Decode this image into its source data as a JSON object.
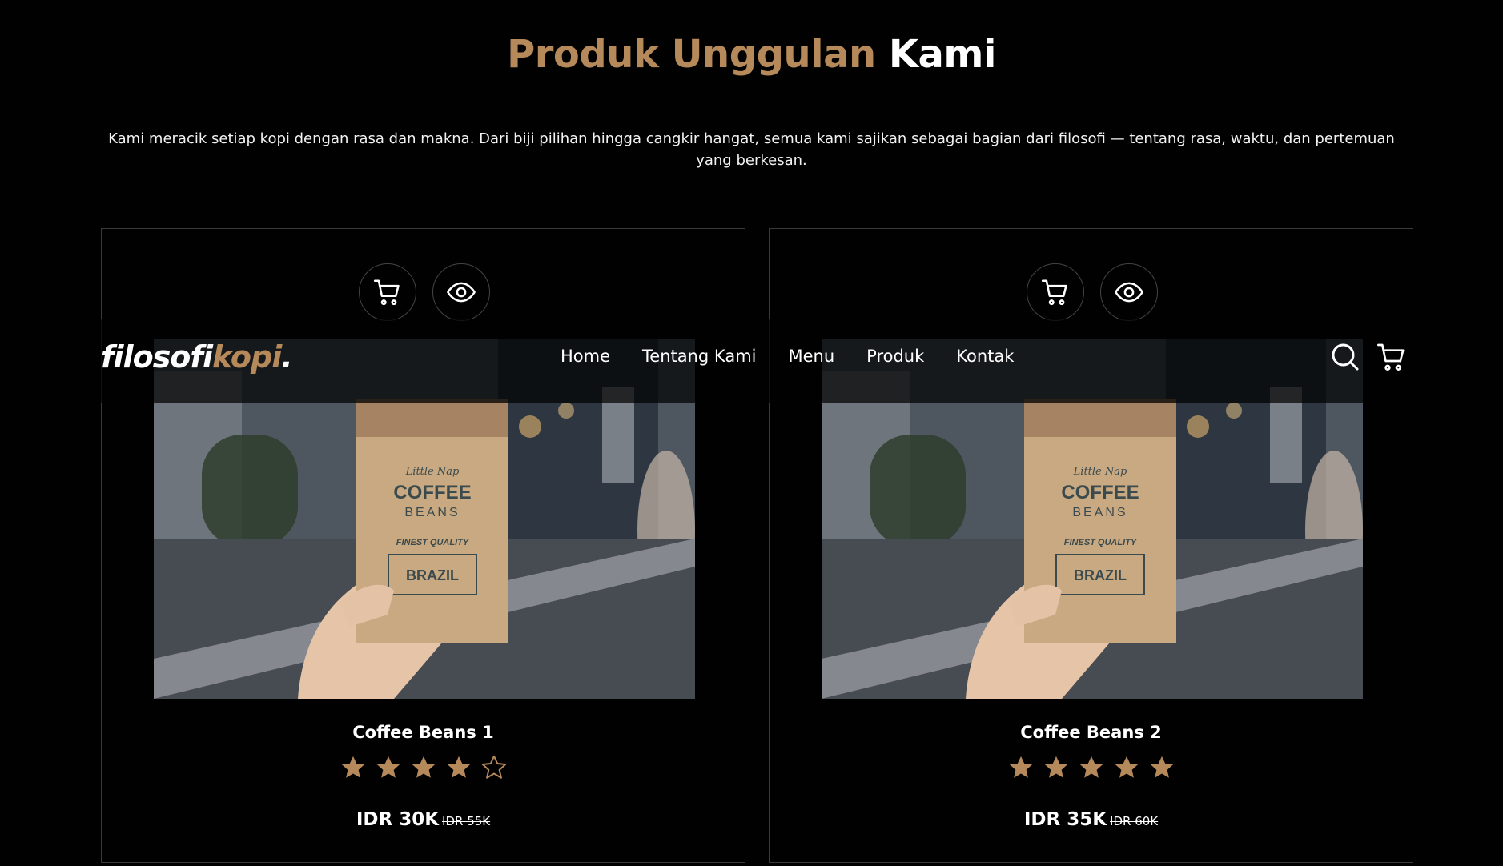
{
  "section": {
    "title_accent": "Produk Unggulan",
    "title_rest": "Kami",
    "subtitle": "Kami meracik setiap kopi dengan rasa dan makna. Dari biji pilihan hingga cangkir hangat, semua kami sajikan sebagai bagian dari filosofi — tentang rasa, waktu, dan pertemuan yang berkesan."
  },
  "navbar": {
    "logo_main": "filosofi",
    "logo_accent": "kopi",
    "logo_dot": ".",
    "links": [
      "Home",
      "Tentang Kami",
      "Menu",
      "Produk",
      "Kontak"
    ],
    "icons": [
      "search-icon",
      "cart-icon"
    ]
  },
  "products": [
    {
      "name": "Coffee Beans 1",
      "rating": 4,
      "rating_max": 5,
      "price": "IDR 30K",
      "old_price": "IDR 55K",
      "bag_text": {
        "brand": "Little Nap",
        "line1": "COFFEE",
        "line2": "BEANS",
        "quality": "FINEST QUALITY",
        "origin": "BRAZIL"
      }
    },
    {
      "name": "Coffee Beans 2",
      "rating": 5,
      "rating_max": 5,
      "price": "IDR 35K",
      "old_price": "IDR 60K",
      "bag_text": {
        "brand": "Little Nap",
        "line1": "COFFEE",
        "line2": "BEANS",
        "quality": "FINEST QUALITY",
        "origin": "BRAZIL"
      }
    }
  ],
  "colors": {
    "accent": "#b6895b",
    "background": "#010101",
    "text": "#ffffff"
  }
}
